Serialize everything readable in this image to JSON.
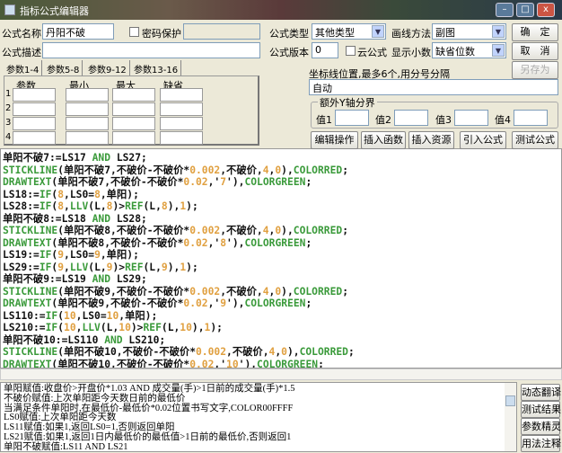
{
  "window": {
    "title": "指标公式编辑器",
    "min": "–",
    "max": "□",
    "close": "x"
  },
  "form": {
    "name_label": "公式名称",
    "name_value": "丹阳不破",
    "password_label": "密码保护",
    "desc_label": "公式描述",
    "desc_value": "",
    "type_label": "公式类型",
    "type_value": "其他类型",
    "draw_label": "画线方法",
    "draw_value": "副图",
    "version_label": "公式版本",
    "version_value": "0",
    "cloud_label": "云公式",
    "decimal_label": "显示小数",
    "decimal_value": "缺省位数",
    "ok": "确　定",
    "cancel": "取　消",
    "save_as": "另存为",
    "coord_label": "坐标线位置,最多6个,用分号分隔",
    "coord_value": "自动",
    "yaxis_group": "额外Y轴分界",
    "values": [
      "值1",
      "值2",
      "值3",
      "值4"
    ],
    "tabs": [
      "参数1-4",
      "参数5-8",
      "参数9-12",
      "参数13-16"
    ],
    "param_headers": [
      "参数",
      "最小",
      "最大",
      "缺省"
    ],
    "row_numbers": [
      "1",
      "2",
      "3",
      "4"
    ],
    "actions": [
      "编辑操作",
      "插入函数",
      "插入资源",
      "引入公式",
      "测试公式"
    ]
  },
  "code_lines": [
    [
      [
        "t",
        "单阳不破7:=LS17 "
      ],
      [
        "f",
        "AND"
      ],
      [
        "t",
        " LS27;"
      ]
    ],
    [
      [
        "f",
        "STICKLINE"
      ],
      [
        "t",
        "(单阳不破7,不破价-不破价*"
      ],
      [
        "n",
        "0.002"
      ],
      [
        "t",
        ",不破价,"
      ],
      [
        "n",
        "4"
      ],
      [
        "t",
        ","
      ],
      [
        "n",
        "0"
      ],
      [
        "t",
        "),"
      ],
      [
        "f",
        "COLORRED"
      ],
      [
        "t",
        ";"
      ]
    ],
    [
      [
        "f",
        "DRAWTEXT"
      ],
      [
        "t",
        "(单阳不破7,不破价-不破价*"
      ],
      [
        "n",
        "0.02"
      ],
      [
        "t",
        ",'"
      ],
      [
        "n",
        "7"
      ],
      [
        "t",
        "'),"
      ],
      [
        "f",
        "COLORGREEN"
      ],
      [
        "t",
        ";"
      ]
    ],
    [
      [
        "t",
        "LS18:="
      ],
      [
        "f",
        "IF"
      ],
      [
        "t",
        "("
      ],
      [
        "n",
        "8"
      ],
      [
        "t",
        ",LS0="
      ],
      [
        "n",
        "8"
      ],
      [
        "t",
        ",单阳);"
      ]
    ],
    [
      [
        "t",
        "LS28:="
      ],
      [
        "f",
        "IF"
      ],
      [
        "t",
        "("
      ],
      [
        "n",
        "8"
      ],
      [
        "t",
        ","
      ],
      [
        "f",
        "LLV"
      ],
      [
        "t",
        "(L,"
      ],
      [
        "n",
        "8"
      ],
      [
        "t",
        ")>"
      ],
      [
        "f",
        "REF"
      ],
      [
        "t",
        "(L,"
      ],
      [
        "n",
        "8"
      ],
      [
        "t",
        "),"
      ],
      [
        "n",
        "1"
      ],
      [
        "t",
        ");"
      ]
    ],
    [
      [
        "t",
        "单阳不破8:=LS18 "
      ],
      [
        "f",
        "AND"
      ],
      [
        "t",
        " LS28;"
      ]
    ],
    [
      [
        "f",
        "STICKLINE"
      ],
      [
        "t",
        "(单阳不破8,不破价-不破价*"
      ],
      [
        "n",
        "0.002"
      ],
      [
        "t",
        ",不破价,"
      ],
      [
        "n",
        "4"
      ],
      [
        "t",
        ","
      ],
      [
        "n",
        "0"
      ],
      [
        "t",
        "),"
      ],
      [
        "f",
        "COLORRED"
      ],
      [
        "t",
        ";"
      ]
    ],
    [
      [
        "f",
        "DRAWTEXT"
      ],
      [
        "t",
        "(单阳不破8,不破价-不破价*"
      ],
      [
        "n",
        "0.02"
      ],
      [
        "t",
        ",'"
      ],
      [
        "n",
        "8"
      ],
      [
        "t",
        "'),"
      ],
      [
        "f",
        "COLORGREEN"
      ],
      [
        "t",
        ";"
      ]
    ],
    [
      [
        "t",
        "LS19:="
      ],
      [
        "f",
        "IF"
      ],
      [
        "t",
        "("
      ],
      [
        "n",
        "9"
      ],
      [
        "t",
        ",LS0="
      ],
      [
        "n",
        "9"
      ],
      [
        "t",
        ",单阳);"
      ]
    ],
    [
      [
        "t",
        "LS29:="
      ],
      [
        "f",
        "IF"
      ],
      [
        "t",
        "("
      ],
      [
        "n",
        "9"
      ],
      [
        "t",
        ","
      ],
      [
        "f",
        "LLV"
      ],
      [
        "t",
        "(L,"
      ],
      [
        "n",
        "9"
      ],
      [
        "t",
        ")>"
      ],
      [
        "f",
        "REF"
      ],
      [
        "t",
        "(L,"
      ],
      [
        "n",
        "9"
      ],
      [
        "t",
        "),"
      ],
      [
        "n",
        "1"
      ],
      [
        "t",
        ");"
      ]
    ],
    [
      [
        "t",
        "单阳不破9:=LS19 "
      ],
      [
        "f",
        "AND"
      ],
      [
        "t",
        " LS29;"
      ]
    ],
    [
      [
        "f",
        "STICKLINE"
      ],
      [
        "t",
        "(单阳不破9,不破价-不破价*"
      ],
      [
        "n",
        "0.002"
      ],
      [
        "t",
        ",不破价,"
      ],
      [
        "n",
        "4"
      ],
      [
        "t",
        ","
      ],
      [
        "n",
        "0"
      ],
      [
        "t",
        "),"
      ],
      [
        "f",
        "COLORRED"
      ],
      [
        "t",
        ";"
      ]
    ],
    [
      [
        "f",
        "DRAWTEXT"
      ],
      [
        "t",
        "(单阳不破9,不破价-不破价*"
      ],
      [
        "n",
        "0.02"
      ],
      [
        "t",
        ",'"
      ],
      [
        "n",
        "9"
      ],
      [
        "t",
        "'),"
      ],
      [
        "f",
        "COLORGREEN"
      ],
      [
        "t",
        ";"
      ]
    ],
    [
      [
        "t",
        "LS110:="
      ],
      [
        "f",
        "IF"
      ],
      [
        "t",
        "("
      ],
      [
        "n",
        "10"
      ],
      [
        "t",
        ",LS0="
      ],
      [
        "n",
        "10"
      ],
      [
        "t",
        ",单阳);"
      ]
    ],
    [
      [
        "t",
        "LS210:="
      ],
      [
        "f",
        "IF"
      ],
      [
        "t",
        "("
      ],
      [
        "n",
        "10"
      ],
      [
        "t",
        ","
      ],
      [
        "f",
        "LLV"
      ],
      [
        "t",
        "(L,"
      ],
      [
        "n",
        "10"
      ],
      [
        "t",
        ")>"
      ],
      [
        "f",
        "REF"
      ],
      [
        "t",
        "(L,"
      ],
      [
        "n",
        "10"
      ],
      [
        "t",
        "),"
      ],
      [
        "n",
        "1"
      ],
      [
        "t",
        ");"
      ]
    ],
    [
      [
        "t",
        "单阳不破10:=LS110 "
      ],
      [
        "f",
        "AND"
      ],
      [
        "t",
        " LS210;"
      ]
    ],
    [
      [
        "f",
        "STICKLINE"
      ],
      [
        "t",
        "(单阳不破10,不破价-不破价*"
      ],
      [
        "n",
        "0.002"
      ],
      [
        "t",
        ",不破价,"
      ],
      [
        "n",
        "4"
      ],
      [
        "t",
        ","
      ],
      [
        "n",
        "0"
      ],
      [
        "t",
        "),"
      ],
      [
        "f",
        "COLORRED"
      ],
      [
        "t",
        ";"
      ]
    ],
    [
      [
        "f",
        "DRAWTEXT"
      ],
      [
        "t",
        "(单阳不破10,不破价-不破价*"
      ],
      [
        "n",
        "0.02"
      ],
      [
        "t",
        ",'"
      ],
      [
        "n",
        "10"
      ],
      [
        "t",
        "'),"
      ],
      [
        "f",
        "COLORGREEN"
      ],
      [
        "t",
        ";"
      ]
    ]
  ],
  "help_lines": [
    "单阳赋值:收盘价>开盘价*1.03 AND 成交量(手)>1日前的成交量(手)*1.5",
    "不破价赋值:上次单阳距今天数日前的最低价",
    "当满足条件单阳时,在最低价-最低价*0.02位置书写文字,COLOR00FFFF",
    "LS0赋值:上次单阳距今天数",
    "LS11赋值:如果1,返回LS0=1,否则返回单阳",
    "LS21赋值:如果1,返回1日内最低价的最低值>1日前的最低价,否则返回1",
    "单阳不破赋值:LS11 AND LS21"
  ],
  "help_buttons": [
    "动态翻译",
    "测试结果",
    "参数精灵",
    "用法注释"
  ]
}
